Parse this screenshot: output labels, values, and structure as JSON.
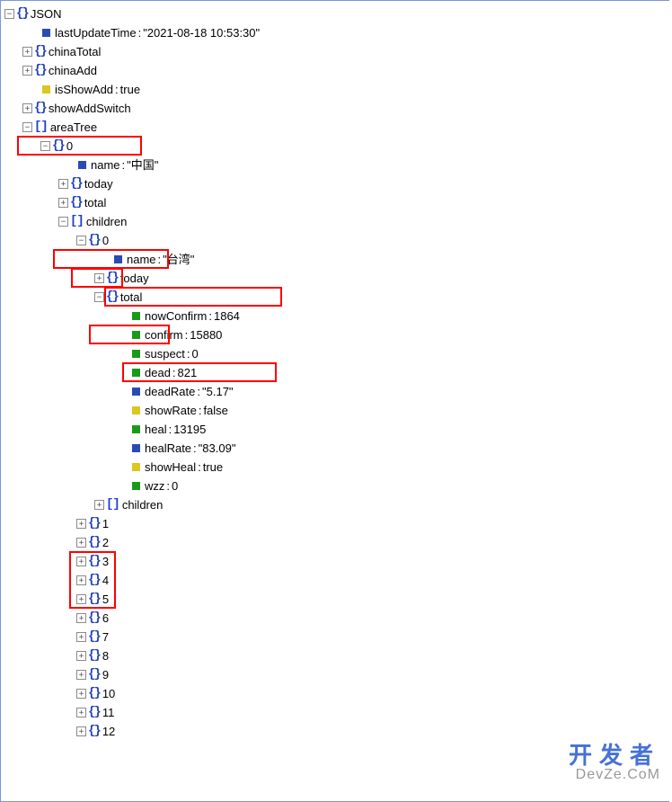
{
  "root": {
    "label": "JSON"
  },
  "lastUpdateTime": {
    "key": "lastUpdateTime",
    "value": "\"2021-08-18 10:53:30\""
  },
  "chinaTotal": {
    "label": "chinaTotal"
  },
  "chinaAdd": {
    "label": "chinaAdd"
  },
  "isShowAdd": {
    "key": "isShowAdd",
    "value": "true"
  },
  "showAddSwitch": {
    "label": "showAddSwitch"
  },
  "areaTree": {
    "label": "areaTree"
  },
  "idx0": {
    "label": "0"
  },
  "name_cn": {
    "key": "name",
    "value": "\"中国\""
  },
  "today0": {
    "label": "today"
  },
  "total0": {
    "label": "total"
  },
  "children0": {
    "label": "children"
  },
  "child0": {
    "label": "0"
  },
  "name_tw": {
    "key": "name",
    "value": "\"台湾\""
  },
  "today1": {
    "label": "today"
  },
  "total1": {
    "label": "total"
  },
  "nowConfirm": {
    "key": "nowConfirm",
    "value": "1864"
  },
  "confirm": {
    "key": "confirm",
    "value": "15880"
  },
  "suspect": {
    "key": "suspect",
    "value": "0"
  },
  "dead": {
    "key": "dead",
    "value": "821"
  },
  "deadRate": {
    "key": "deadRate",
    "value": "\"5.17\""
  },
  "showRate": {
    "key": "showRate",
    "value": "false"
  },
  "heal": {
    "key": "heal",
    "value": "13195"
  },
  "healRate": {
    "key": "healRate",
    "value": "\"83.09\""
  },
  "showHeal": {
    "key": "showHeal",
    "value": "true"
  },
  "wzz": {
    "key": "wzz",
    "value": "0"
  },
  "children1": {
    "label": "children"
  },
  "idx1": {
    "label": "1"
  },
  "idx2": {
    "label": "2"
  },
  "idx3": {
    "label": "3"
  },
  "idx4": {
    "label": "4"
  },
  "idx5": {
    "label": "5"
  },
  "idx6": {
    "label": "6"
  },
  "idx7": {
    "label": "7"
  },
  "idx8": {
    "label": "8"
  },
  "idx9": {
    "label": "9"
  },
  "idx10": {
    "label": "10"
  },
  "idx11": {
    "label": "11"
  },
  "idx12": {
    "label": "12"
  },
  "watermark": {
    "ch": "开发者",
    "en": "DevZe.CoM"
  },
  "glyph": {
    "plus": "+",
    "minus": "−"
  }
}
